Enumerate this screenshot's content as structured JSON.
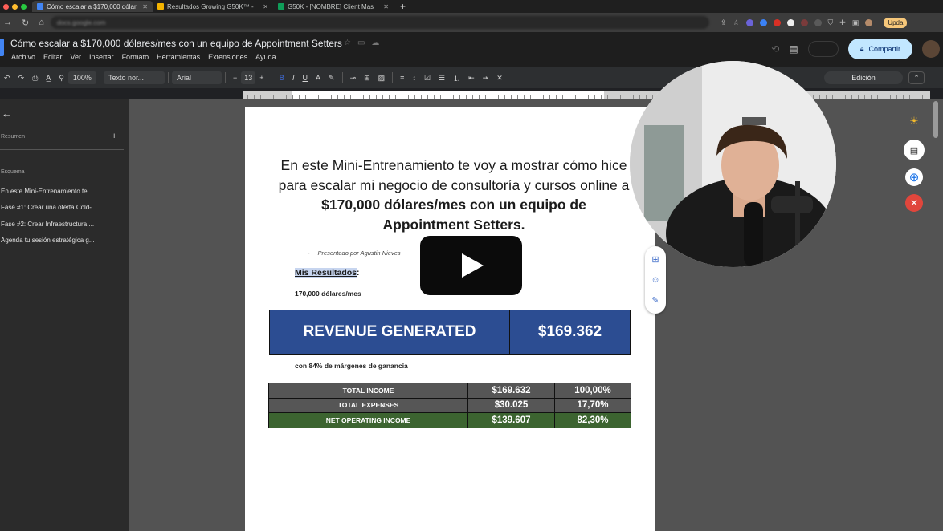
{
  "browser": {
    "tabs": [
      {
        "label": "Cómo escalar a $170,000 dólar",
        "icon": "docs-icon",
        "color": "#4285f4",
        "active": true
      },
      {
        "label": "Resultados Growing G50K™ -",
        "icon": "slides-icon",
        "color": "#f4b400",
        "active": false
      },
      {
        "label": "G50K - [NOMBRE] Client Mas",
        "icon": "sheets-icon",
        "color": "#0f9d58",
        "active": false
      }
    ],
    "new_tab": "+",
    "url": "docs.google.com",
    "update_label": "Upda"
  },
  "docs": {
    "title": "Cómo escalar a $170,000 dólares/mes con un equipo de Appointment Setters",
    "menu": [
      "Archivo",
      "Editar",
      "Ver",
      "Insertar",
      "Formato",
      "Herramientas",
      "Extensiones",
      "Ayuda"
    ],
    "share_label": "Compartir",
    "toolbar": {
      "zoom": "100%",
      "style": "Texto nor...",
      "font": "Arial",
      "font_size": "13",
      "mode": "Edición"
    }
  },
  "sidebar": {
    "summary_label": "Resumen",
    "outline_label": "Esquema",
    "items": [
      "En este Mini-Entrenamiento te ...",
      "Fase #1: Crear una oferta Cold-...",
      "Fase #2: Crear Infraestructura ...",
      "Agenda tu sesión estratégica g..."
    ]
  },
  "document": {
    "heading_part1": "En este Mini-Entrenamiento te voy a mostrar cómo hice para escalar mi negocio de consultoría y cursos online a ",
    "heading_bold": "$170,000 dólares/mes con un equipo de Appointment Setters.",
    "presented_by": "Presentado por Agustin Nieves",
    "results_label": "Mis Resultados",
    "results_colon": ":",
    "results_sub": "170,000 dólares/mes",
    "revenue_label": "REVENUE GENERATED",
    "revenue_value": "$169.362",
    "margin_note": "con 84% de márgenes de ganancia",
    "table": [
      {
        "label": "TOTAL INCOME",
        "amount": "$169.632",
        "pct": "100,00%"
      },
      {
        "label": "TOTAL EXPENSES",
        "amount": "$30.025",
        "pct": "17,70%"
      },
      {
        "label": "NET OPERATING INCOME",
        "amount": "$139.607",
        "pct": "82,30%"
      }
    ]
  },
  "colors": {
    "revenue_blue": "#2c4d92",
    "table_gray": "#565656",
    "net_green": "#3c6430",
    "share_bg": "#c2e7ff"
  }
}
